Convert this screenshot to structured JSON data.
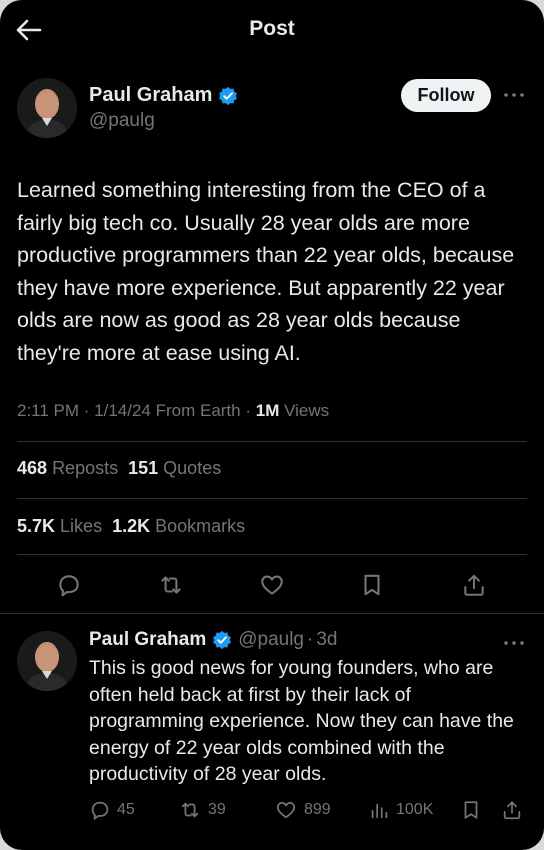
{
  "header": {
    "title": "Post"
  },
  "post": {
    "author_name": "Paul Graham",
    "author_handle": "@paulg",
    "follow_label": "Follow",
    "text": "Learned something interesting from the CEO of a fairly big tech co. Usually 28 year olds are more productive programmers than 22 year olds, because they have more experience. But apparently 22 year olds are now as good as 28 year olds because they're more at ease using AI.",
    "timestamp": "2:11 PM · 1/14/24 From Earth · ",
    "views_count": "1M",
    "views_label": " Views",
    "reposts_count": "468",
    "reposts_label": "Reposts",
    "quotes_count": "151",
    "quotes_label": "Quotes",
    "likes_count": "5.7K",
    "likes_label": "Likes",
    "bookmarks_count": "1.2K",
    "bookmarks_label": "Bookmarks"
  },
  "reply": {
    "author_name": "Paul Graham",
    "author_handle": "@paulg",
    "separator": "·",
    "time": "3d",
    "text": "This is good news for young founders, who are often held back at first by their lack of programming experience. Now they can have the energy of 22 year olds combined with the productivity of 28 year olds.",
    "replies": "45",
    "reposts": "39",
    "likes": "899",
    "views": "100K"
  },
  "colors": {
    "background": "#000000",
    "text_primary": "#e7e9ea",
    "text_secondary": "#71767b",
    "verified_blue": "#1d9bf0",
    "divider": "#2f3336"
  },
  "icons": [
    "back-arrow-icon",
    "verified-badge-icon",
    "more-icon",
    "reply-icon",
    "repost-icon",
    "like-icon",
    "bookmark-icon",
    "share-icon",
    "views-icon"
  ]
}
